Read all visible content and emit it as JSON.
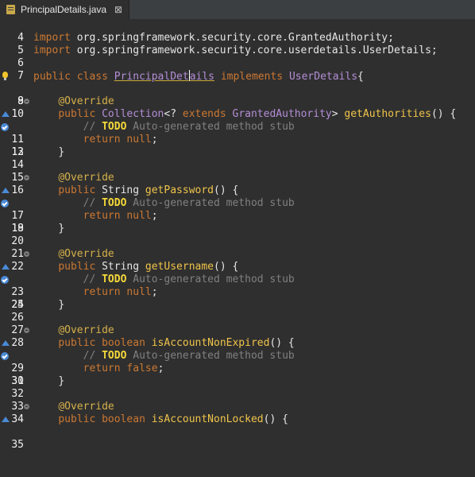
{
  "tab": {
    "title": "PrincipalDetails.java",
    "close": "⊠"
  },
  "lines": {
    "l4": {
      "num": "4"
    },
    "l5": {
      "num": "5",
      "kw": "import",
      "rest": "org.springframework.security.core.GrantedAuthority;"
    },
    "l6": {
      "num": "6",
      "kw": "import",
      "rest": "org.springframework.security.core.userdetails.UserDetails;"
    },
    "l7": {
      "num": "7"
    },
    "l8": {
      "num": "8",
      "kw1": "public",
      "kw2": "class",
      "cls_a": "PrincipalDet",
      "cls_b": "ails",
      "kw3": "implements",
      "iface": "UserDetails",
      "brace": "{"
    },
    "l9": {
      "num": "9"
    },
    "l10": {
      "num": "10",
      "ann": "@Override"
    },
    "l11": {
      "num": "11",
      "kw": "public",
      "t1": "Collection",
      "p1": "<?",
      "kw2": "extends",
      "t2": "GrantedAuthority",
      "p2": ">",
      "m": "getAuthorities",
      "p3": "() {"
    },
    "l12": {
      "num": "12",
      "c1": "//",
      "todo": "TODO",
      "c2": "Auto-generated method stub"
    },
    "l13": {
      "num": "13",
      "kw": "return",
      "kw2": "null",
      "p": ";"
    },
    "l14": {
      "num": "14",
      "p": "}"
    },
    "l15": {
      "num": "15"
    },
    "l16": {
      "num": "16",
      "ann": "@Override"
    },
    "l17": {
      "num": "17",
      "kw": "public",
      "t": "String",
      "m": "getPassword",
      "p": "() {"
    },
    "l18": {
      "num": "18",
      "c1": "//",
      "todo": "TODO",
      "c2": "Auto-generated method stub"
    },
    "l19": {
      "num": "19",
      "kw": "return",
      "kw2": "null",
      "p": ";"
    },
    "l20": {
      "num": "20",
      "p": "}"
    },
    "l21": {
      "num": "21"
    },
    "l22": {
      "num": "22",
      "ann": "@Override"
    },
    "l23": {
      "num": "23",
      "kw": "public",
      "t": "String",
      "m": "getUsername",
      "p": "() {"
    },
    "l24": {
      "num": "24",
      "c1": "//",
      "todo": "TODO",
      "c2": "Auto-generated method stub"
    },
    "l25": {
      "num": "25",
      "kw": "return",
      "kw2": "null",
      "p": ";"
    },
    "l26": {
      "num": "26",
      "p": "}"
    },
    "l27": {
      "num": "27"
    },
    "l28": {
      "num": "28",
      "ann": "@Override"
    },
    "l29": {
      "num": "29",
      "kw": "public",
      "kw2": "boolean",
      "m": "isAccountNonExpired",
      "p": "() {"
    },
    "l30": {
      "num": "30",
      "c1": "//",
      "todo": "TODO",
      "c2": "Auto-generated method stub"
    },
    "l31": {
      "num": "31",
      "kw": "return",
      "kw2": "false",
      "p": ";"
    },
    "l32": {
      "num": "32",
      "p": "}"
    },
    "l33": {
      "num": "33"
    },
    "l34": {
      "num": "34",
      "ann": "@Override"
    },
    "l35": {
      "num": "35",
      "kw": "public",
      "kw2": "boolean",
      "m": "isAccountNonLocked",
      "p": "() {"
    }
  }
}
